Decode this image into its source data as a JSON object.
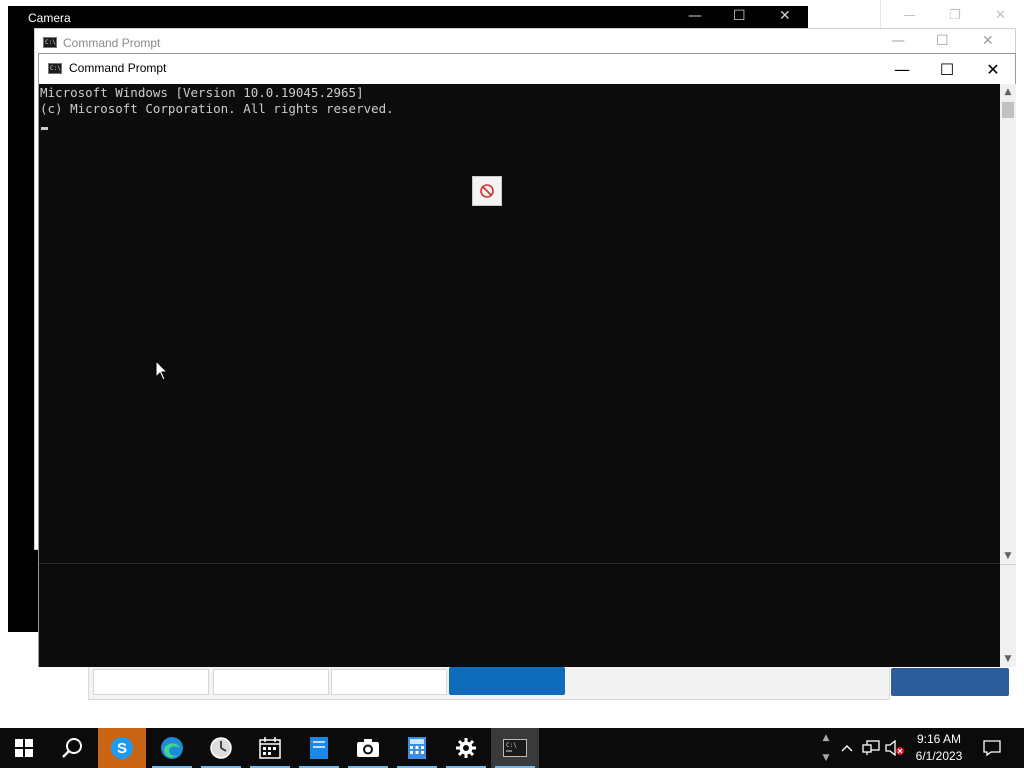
{
  "windows": {
    "camera": {
      "title": "Camera",
      "minimize": "—",
      "maximize": "☐",
      "close": "✕"
    },
    "cmd_back": {
      "title": "Command Prompt",
      "minimize": "—",
      "maximize": "☐",
      "close": "✕"
    },
    "cmd_front": {
      "title": "Command Prompt",
      "minimize": "—",
      "maximize": "☐",
      "close": "✕"
    }
  },
  "console": {
    "lines": [
      "Microsoft Windows [Version 10.0.19045.2965]",
      "(c) Microsoft Corporation. All rights reserved."
    ]
  },
  "taskbar": {
    "items": [
      {
        "name": "start-button",
        "icon": "windows-logo-icon"
      },
      {
        "name": "search-button",
        "icon": "search-icon"
      },
      {
        "name": "skype",
        "icon": "skype-icon"
      },
      {
        "name": "edge",
        "icon": "edge-icon"
      },
      {
        "name": "alarms-clock",
        "icon": "clock-icon"
      },
      {
        "name": "calendar",
        "icon": "calendar-icon"
      },
      {
        "name": "notepad",
        "icon": "notepad-icon"
      },
      {
        "name": "camera",
        "icon": "camera-icon"
      },
      {
        "name": "calculator",
        "icon": "calculator-icon"
      },
      {
        "name": "settings",
        "icon": "gear-icon"
      },
      {
        "name": "command-prompt",
        "icon": "terminal-icon"
      }
    ],
    "clock": {
      "time": "9:16 AM",
      "date": "6/1/2023"
    }
  },
  "colors": {
    "taskbar": "#0b0b0b",
    "console_bg": "#0c0c0c",
    "console_text": "#cccccc",
    "active_indicator": "#76b9ed",
    "skype_highlight": "#c86414"
  }
}
